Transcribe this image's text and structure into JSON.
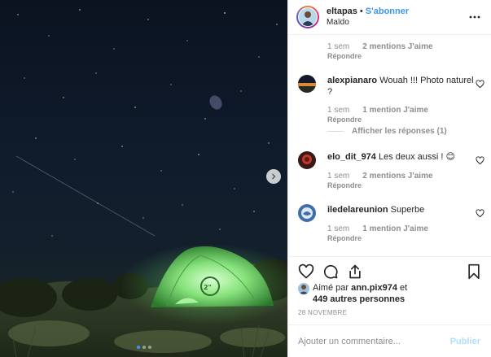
{
  "header": {
    "username": "eltapas",
    "separator": "•",
    "follow_label": "S'abonner",
    "location": "Maïdo",
    "more_icon": "more-horizontal-icon"
  },
  "comments": [
    {
      "username": "",
      "text": "",
      "time": "1 sem",
      "likes": "2 mentions J'aime",
      "reply_label": "Répondre"
    },
    {
      "username": "alexpianaro",
      "text": "Wouah !!! Photo naturel ?",
      "time": "1 sem",
      "likes": "1 mention J'aime",
      "reply_label": "Répondre",
      "show_replies": "Afficher les réponses (1)"
    },
    {
      "username": "elo_dit_974",
      "text": "Les deux aussi !",
      "emoji": "😊",
      "time": "1 sem",
      "likes": "2 mentions J'aime",
      "reply_label": "Répondre"
    },
    {
      "username": "iledelareunion",
      "text": "Superbe",
      "time": "1 sem",
      "likes": "1 mention J'aime",
      "reply_label": "Répondre"
    }
  ],
  "actions": {
    "like_icon": "heart-icon",
    "comment_icon": "comment-icon",
    "share_icon": "share-icon",
    "save_icon": "bookmark-icon"
  },
  "liked_by": {
    "prefix": "Aimé par",
    "user": "ann.pix974",
    "and": "et",
    "others": "449 autres personnes"
  },
  "date": "28 NOVEMBRE",
  "add_comment": {
    "placeholder": "Ajouter un commentaire...",
    "post_label": "Publier"
  },
  "carousel": {
    "slides": 3,
    "active": 0
  },
  "colors": {
    "link": "#3897f0",
    "muted": "#8e8e8e",
    "post_disabled": "#b2dffc"
  }
}
